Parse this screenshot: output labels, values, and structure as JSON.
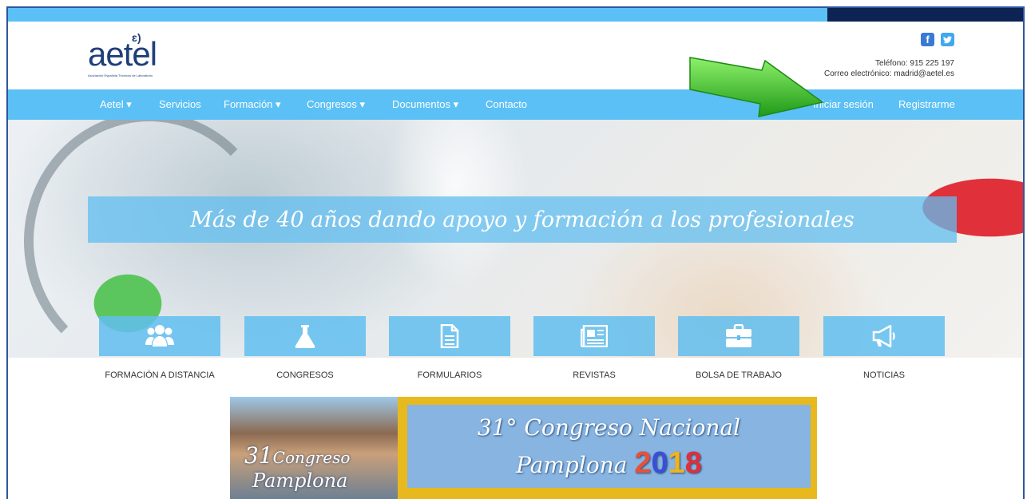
{
  "header": {
    "logo_text": "aetel",
    "logo_tagline": "Asociación Española Técnicos de Laboratorio",
    "phone": "Teléfono: 915 225 197",
    "email": "Correo electrónico: madrid@aetel.es"
  },
  "nav": {
    "items": [
      {
        "label": "Aetel ▾"
      },
      {
        "label": "Servicios"
      },
      {
        "label": "Formación ▾"
      },
      {
        "label": "Congresos ▾"
      },
      {
        "label": "Documentos ▾"
      },
      {
        "label": "Contacto"
      }
    ],
    "login": "Iniciar sesión",
    "register": "Registrarme"
  },
  "hero": {
    "slogan": "Más de 40 años dando apoyo y formación a los profesionales"
  },
  "tiles": [
    {
      "label": "FORMACIÓN A DISTANCIA",
      "icon": "users-icon"
    },
    {
      "label": "CONGRESOS",
      "icon": "flask-icon"
    },
    {
      "label": "FORMULARIOS",
      "icon": "document-icon"
    },
    {
      "label": "REVISTAS",
      "icon": "newspaper-icon"
    },
    {
      "label": "BOLSA DE TRABAJO",
      "icon": "briefcase-icon"
    },
    {
      "label": "NOTICIAS",
      "icon": "megaphone-icon"
    }
  ],
  "ad": {
    "left_line1": "31",
    "left_line2": "Congreso",
    "left_line3": "Pamplona",
    "line1": "31° Congreso Nacional",
    "line2_text": "Pamplona",
    "year_2": "2",
    "year_0": "0",
    "year_1": "1",
    "year_8": "8"
  },
  "colors": {
    "accent": "#5bc0f5",
    "dark_bar": "#0d2354",
    "arrow": "#3fcf2a"
  }
}
